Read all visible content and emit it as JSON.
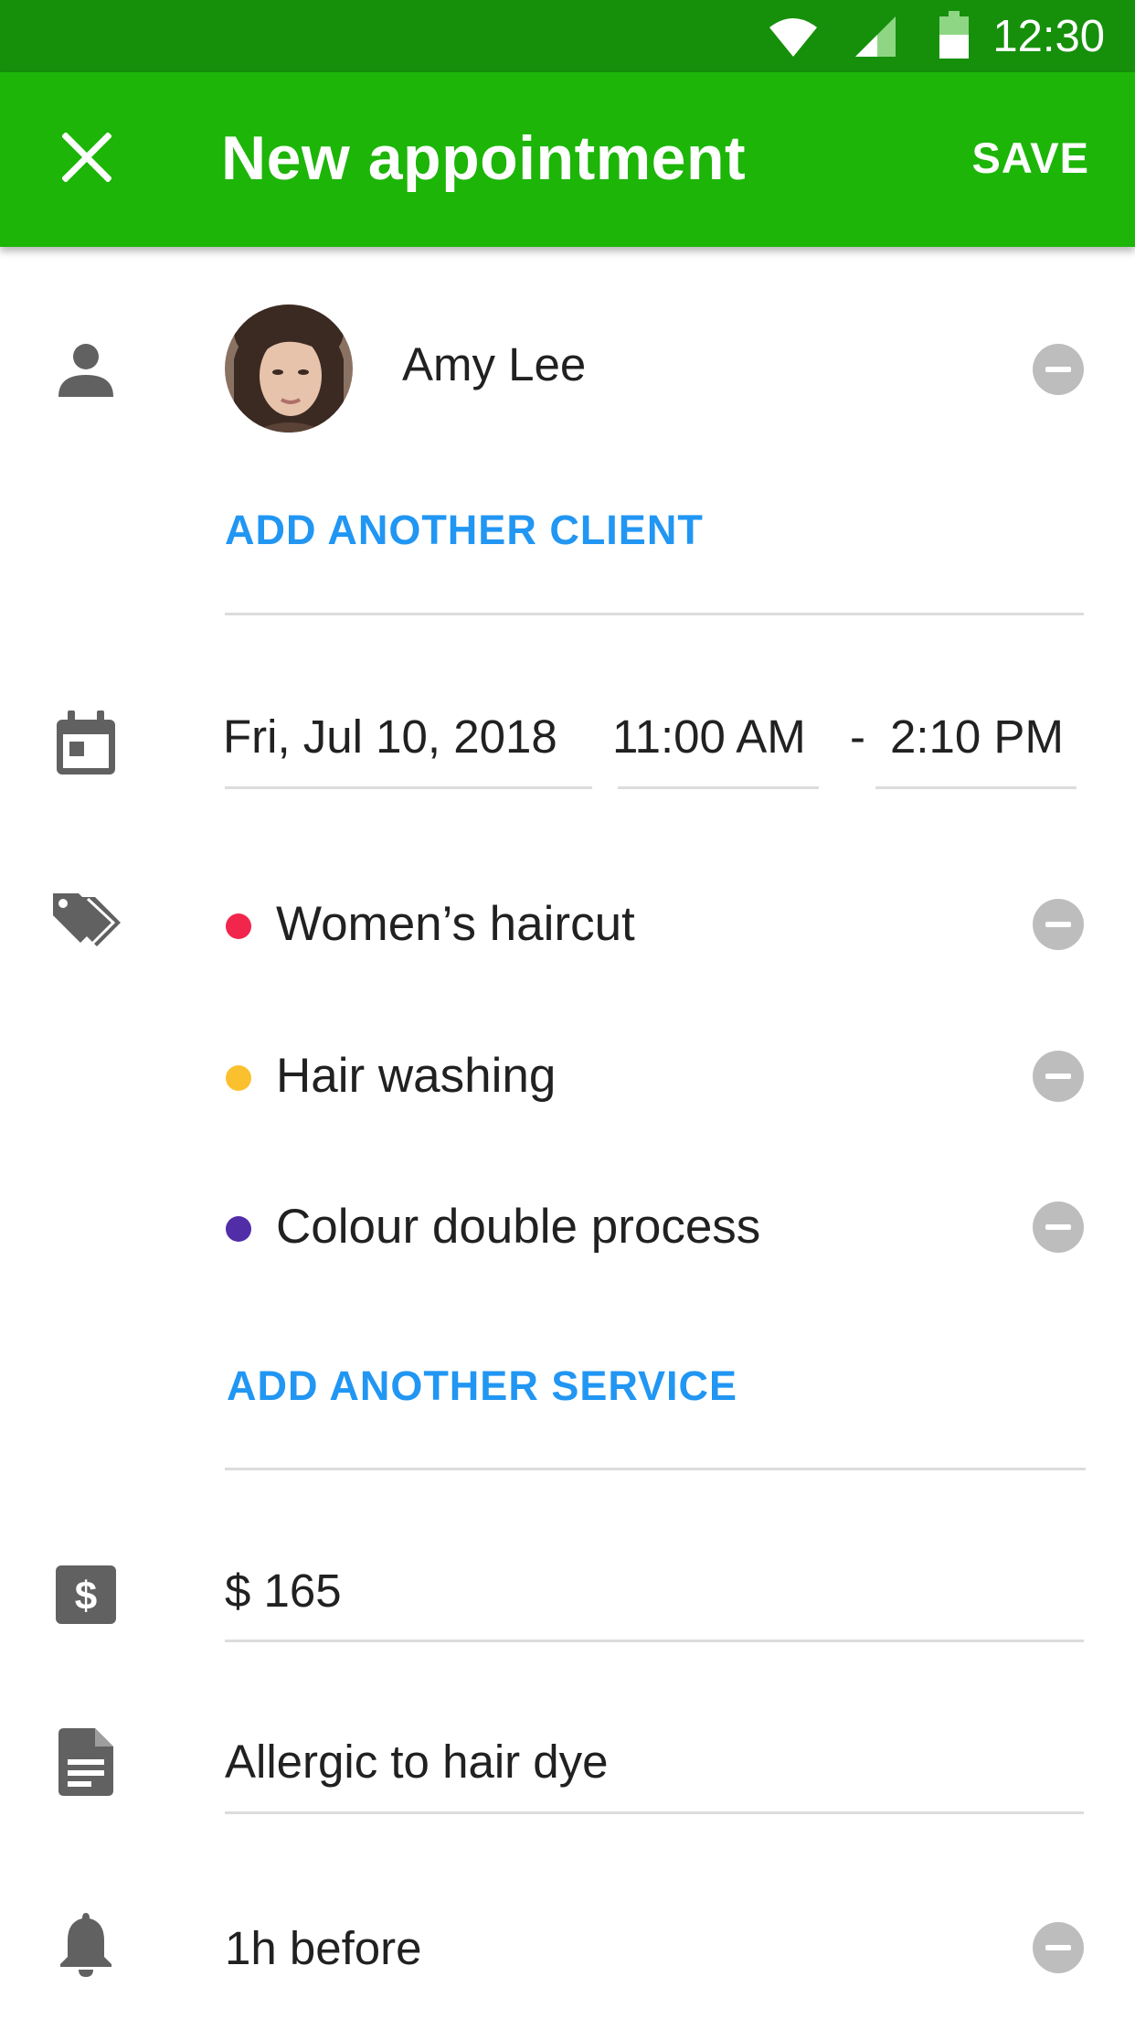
{
  "status_bar": {
    "time": "12:30",
    "icons": [
      "wifi-icon",
      "signal-icon",
      "battery-icon"
    ]
  },
  "app_bar": {
    "title": "New appointment",
    "close_icon": "close-icon",
    "save_label": "SAVE",
    "color": "#1cb508"
  },
  "client": {
    "name": "Amy Lee",
    "add_label": "ADD ANOTHER CLIENT"
  },
  "schedule": {
    "date": "Fri, Jul 10, 2018",
    "start_time": "11:00 AM",
    "separator": "-",
    "end_time": "2:10 PM"
  },
  "services": {
    "items": [
      {
        "label": "Women’s haircut",
        "color": "#f2254c"
      },
      {
        "label": "Hair washing",
        "color": "#fbc02d"
      },
      {
        "label": "Colour double process",
        "color": "#512da8"
      }
    ],
    "add_label": "ADD ANOTHER SERVICE"
  },
  "price": {
    "value": "$ 165"
  },
  "notes": {
    "value": "Allergic to hair dye"
  },
  "reminder": {
    "value": "1h before"
  },
  "accent_link_color": "#2196f3"
}
